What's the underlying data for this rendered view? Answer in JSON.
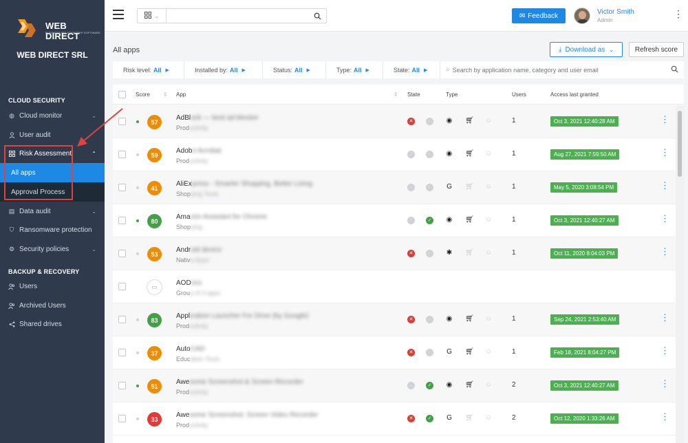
{
  "brand": {
    "logo_text": "WEB DIRECT",
    "logo_sub": "BUSINESS RELATIONSHIP SOFTWARE"
  },
  "sidebar": {
    "company": "WEB DIRECT SRL",
    "section_cloud": "CLOUD SECURITY",
    "section_backup": "BACKUP & RECOVERY",
    "items": [
      {
        "label": "Cloud monitor",
        "icon": "globe-icon"
      },
      {
        "label": "User audit",
        "icon": "user-icon"
      },
      {
        "label": "Risk Assessment",
        "icon": "grid-icon"
      },
      {
        "label": "All apps"
      },
      {
        "label": "Approval Process"
      },
      {
        "label": "Data audit",
        "icon": "document-icon"
      },
      {
        "label": "Ransomware protection",
        "icon": "shield-icon"
      },
      {
        "label": "Security policies",
        "icon": "gear-icon"
      },
      {
        "label": "Users",
        "icon": "users-icon"
      },
      {
        "label": "Archived Users",
        "icon": "archived-users-icon"
      },
      {
        "label": "Shared drives",
        "icon": "share-icon"
      }
    ]
  },
  "topbar": {
    "search_placeholder": "",
    "feedback_label": "Feedback",
    "user_name": "Victor Smith",
    "user_role": "Admin"
  },
  "page": {
    "title": "All apps",
    "download_label": "Download as",
    "refresh_label": "Refresh score"
  },
  "filters": [
    {
      "label": "Risk level:",
      "value": "All"
    },
    {
      "label": "Installed by:",
      "value": "All"
    },
    {
      "label": "Status:",
      "value": "All"
    },
    {
      "label": "Type:",
      "value": "All"
    },
    {
      "label": "State:",
      "value": "All"
    }
  ],
  "filter_search_placeholder": "Search by application name, category and user email",
  "table": {
    "headers": {
      "score": "Score",
      "app": "App",
      "state": "State",
      "type": "Type",
      "users": "Users",
      "access": "Access last granted"
    },
    "rows": [
      {
        "score": "57",
        "score_color": "#f08c00",
        "dot": "#43a047",
        "name": "AdBl",
        "name_blur": "ock — best ad blocker",
        "cat": "Prod",
        "cat_blur": "uctivity",
        "state": [
          "red",
          "grey"
        ],
        "type": [
          "chrome",
          "cart",
          "user-dim"
        ],
        "users": "1",
        "access": "Oct 3, 2021 12:40:28 AM"
      },
      {
        "score": "59",
        "score_color": "#f08c00",
        "dot": "#cfd2d6",
        "name": "Adob",
        "name_blur": "e Acrobat",
        "cat": "Prod",
        "cat_blur": "uctivity",
        "state": [
          "grey",
          "grey"
        ],
        "type": [
          "chrome",
          "cart",
          "user-dim"
        ],
        "users": "1",
        "access": "Aug 27, 2021 7:59:50 AM"
      },
      {
        "score": "41",
        "score_color": "#f08c00",
        "dot": "#cfd2d6",
        "name": "AliEx",
        "name_blur": "press - Smarter Shopping, Better Living",
        "cat": "Shop",
        "cat_blur": "ping Tools",
        "state": [
          "grey",
          "grey"
        ],
        "type": [
          "google",
          "cart-dim",
          "user-dim"
        ],
        "users": "1",
        "access": "May 5, 2020 3:08:54 PM"
      },
      {
        "score": "80",
        "score_color": "#43a047",
        "dot": "#43a047",
        "name": "Ama",
        "name_blur": "zon Assistant for Chrome",
        "cat": "Shop",
        "cat_blur": "ping",
        "state": [
          "grey",
          "green"
        ],
        "type": [
          "chrome",
          "cart",
          "user-dim"
        ],
        "users": "1",
        "access": "Oct 3, 2021 12:40:27 AM"
      },
      {
        "score": "53",
        "score_color": "#f08c00",
        "dot": "#cfd2d6",
        "name": "Andr",
        "name_blur": "oid device",
        "cat": "Nativ",
        "cat_blur": "e Apps",
        "state": [
          "red",
          "grey"
        ],
        "type": [
          "android",
          "cart-dim",
          "user-dim"
        ],
        "users": "1",
        "access": "Oct 11, 2020 8:04:03 PM"
      },
      {
        "score": "",
        "score_color": "",
        "dot": "",
        "name": "AOD",
        "name_blur": "ocs",
        "cat": "Grou",
        "cat_blur": "p of 3 apps",
        "state": [],
        "type": [],
        "users": "",
        "access": ""
      },
      {
        "score": "83",
        "score_color": "#43a047",
        "dot": "#cfd2d6",
        "name": "Appl",
        "name_blur": "ication Launcher For Drive (by Google)",
        "cat": "Prod",
        "cat_blur": "uctivity",
        "state": [
          "red",
          "grey"
        ],
        "type": [
          "chrome",
          "cart",
          "user-dim"
        ],
        "users": "1",
        "access": "Sep 24, 2021 2:53:40 AM"
      },
      {
        "score": "37",
        "score_color": "#f08c00",
        "dot": "#cfd2d6",
        "name": "Auto",
        "name_blur": "CAD",
        "cat": "Educ",
        "cat_blur": "ation Tools",
        "state": [
          "red",
          "grey"
        ],
        "type": [
          "google",
          "cart",
          "user-dim"
        ],
        "users": "1",
        "access": "Feb 18, 2021 8:04:27 PM"
      },
      {
        "score": "51",
        "score_color": "#f08c00",
        "dot": "#43a047",
        "name": "Awe",
        "name_blur": "some Screenshot & Screen Recorder",
        "cat": "Prod",
        "cat_blur": "uctivity",
        "state": [
          "grey",
          "green"
        ],
        "type": [
          "chrome",
          "cart",
          "user-dim"
        ],
        "users": "2",
        "access": "Oct 3, 2021 12:40:27 AM"
      },
      {
        "score": "33",
        "score_color": "#e53935",
        "dot": "#cfd2d6",
        "name": "Awe",
        "name_blur": "some Screenshot: Screen Video Recorder",
        "cat": "Prod",
        "cat_blur": "uctivity",
        "state": [
          "red",
          "green"
        ],
        "type": [
          "google",
          "cart-dim",
          "user-dim"
        ],
        "users": "2",
        "access": "Oct 12, 2020 1:33:26 AM"
      }
    ]
  },
  "colors": {
    "accent": "#1e88e5",
    "sidebar": "#2f3b4c",
    "badge": "#4caf50",
    "annotation": "#e0433d"
  }
}
